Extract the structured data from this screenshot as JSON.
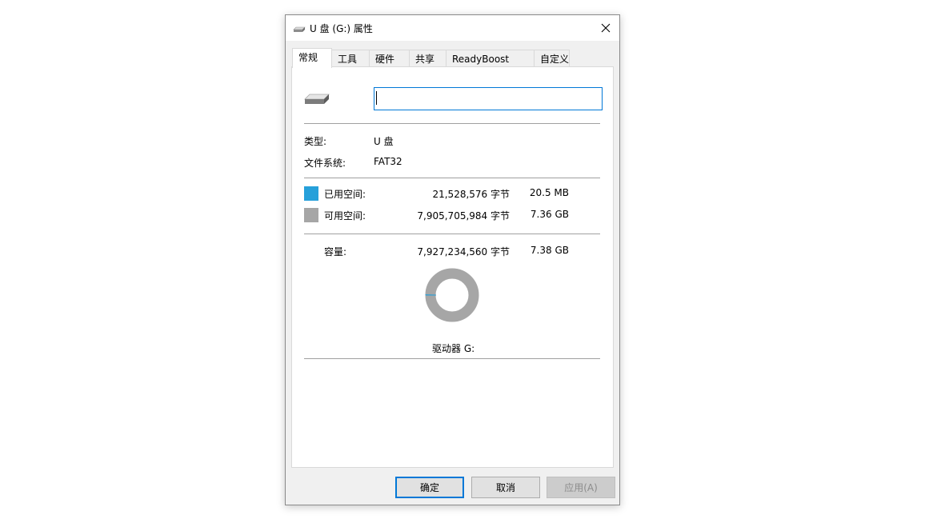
{
  "window": {
    "title": "U 盘 (G:) 属性"
  },
  "tabs": [
    {
      "label": "常规",
      "active": true
    },
    {
      "label": "工具",
      "active": false
    },
    {
      "label": "硬件",
      "active": false
    },
    {
      "label": "共享",
      "active": false
    },
    {
      "label": "ReadyBoost",
      "active": false
    },
    {
      "label": "自定义",
      "active": false
    }
  ],
  "general": {
    "drive_icon": "usb-drive-icon",
    "volume_label_value": "",
    "type_label": "类型:",
    "type_value": "U 盘",
    "fs_label": "文件系统:",
    "fs_value": "FAT32",
    "used": {
      "label": "已用空间:",
      "bytes": "21,528,576 字节",
      "size": "20.5 MB",
      "color": "#26a0da"
    },
    "free": {
      "label": "可用空间:",
      "bytes": "7,905,705,984 字节",
      "size": "7.36 GB",
      "color": "#a6a6a6"
    },
    "capacity": {
      "label": "容量:",
      "bytes": "7,927,234,560 字节",
      "size": "7.38 GB"
    },
    "used_fraction": 0.0027,
    "drive_caption": "驱动器 G:"
  },
  "buttons": {
    "ok": "确定",
    "cancel": "取消",
    "apply": "应用(A)"
  }
}
